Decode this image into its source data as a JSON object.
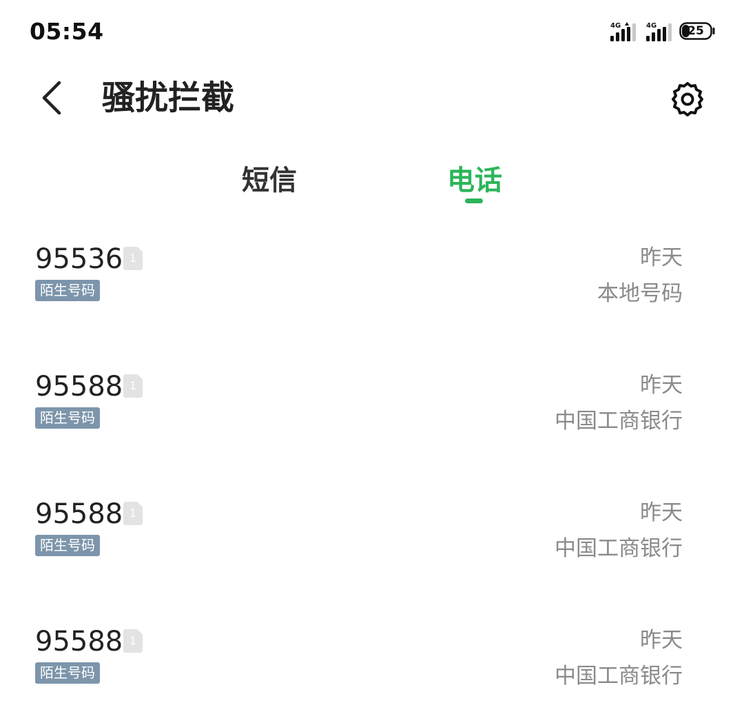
{
  "status_bar": {
    "time": "05:54",
    "signal_1_label": "4G",
    "signal_2_label": "4G",
    "battery": "25"
  },
  "header": {
    "title": "骚扰拦截",
    "back_icon": "chevron-left-icon",
    "settings_icon": "gear-icon"
  },
  "tabs": [
    {
      "label": "短信",
      "active": false
    },
    {
      "label": "电话",
      "active": true
    }
  ],
  "colors": {
    "accent": "#2bb55a",
    "tag_bg": "#7d95ab",
    "secondary_text": "#8a8a8a"
  },
  "calls": [
    {
      "number": "95536",
      "sim": "1",
      "tag": "陌生号码",
      "time": "昨天",
      "location": "本地号码"
    },
    {
      "number": "95588",
      "sim": "1",
      "tag": "陌生号码",
      "time": "昨天",
      "location": "中国工商银行"
    },
    {
      "number": "95588",
      "sim": "1",
      "tag": "陌生号码",
      "time": "昨天",
      "location": "中国工商银行"
    },
    {
      "number": "95588",
      "sim": "1",
      "tag": "陌生号码",
      "time": "昨天",
      "location": "中国工商银行"
    }
  ]
}
